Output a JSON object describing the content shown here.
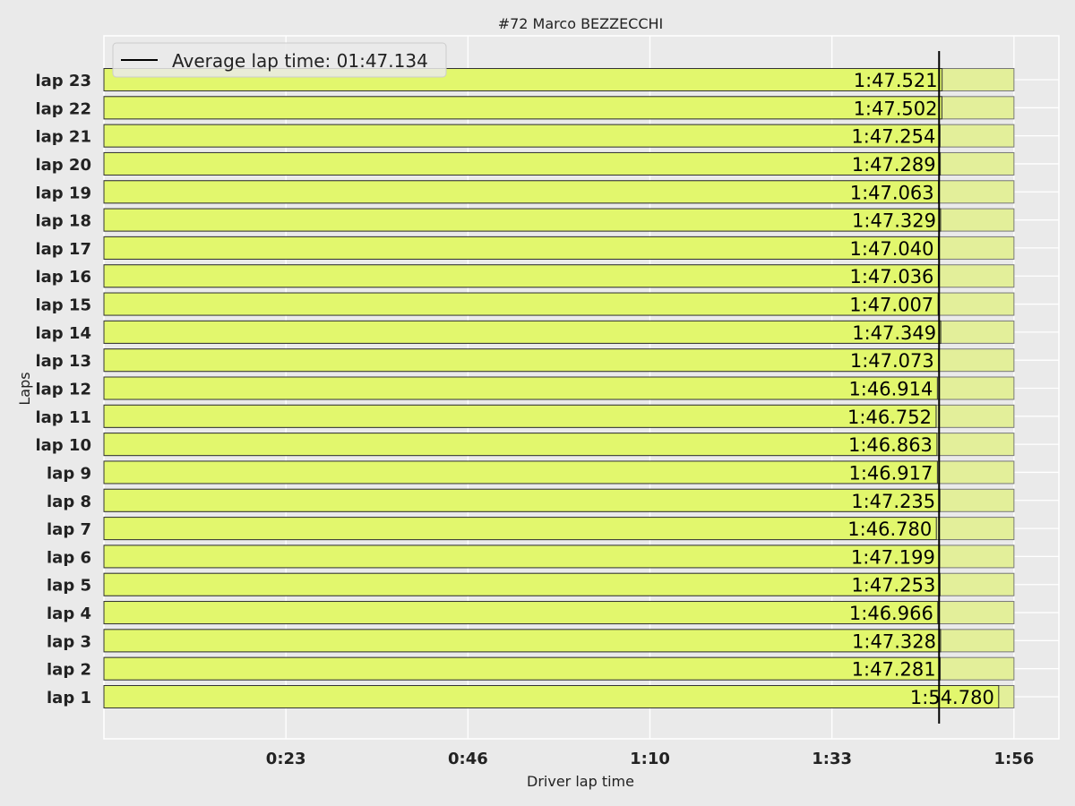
{
  "chart_data": {
    "type": "bar",
    "orientation": "horizontal",
    "title": "#72  Marco BEZZECCHI",
    "xlabel": "Driver lap time",
    "ylabel": "Laps",
    "categories": [
      "lap 1",
      "lap 2",
      "lap 3",
      "lap 4",
      "lap 5",
      "lap 6",
      "lap 7",
      "lap 8",
      "lap 9",
      "lap 10",
      "lap 11",
      "lap 12",
      "lap 13",
      "lap 14",
      "lap 15",
      "lap 16",
      "lap 17",
      "lap 18",
      "lap 19",
      "lap 20",
      "lap 21",
      "lap 22",
      "lap 23"
    ],
    "values_seconds": [
      114.78,
      107.281,
      107.328,
      106.966,
      107.253,
      107.199,
      106.78,
      107.235,
      106.917,
      106.863,
      106.752,
      106.914,
      107.073,
      107.349,
      107.007,
      107.036,
      107.04,
      107.329,
      107.063,
      107.289,
      107.254,
      107.502,
      107.521
    ],
    "value_labels": [
      "1:54.780",
      "1:47.281",
      "1:47.328",
      "1:46.966",
      "1:47.253",
      "1:47.199",
      "1:46.780",
      "1:47.235",
      "1:46.917",
      "1:46.863",
      "1:46.752",
      "1:46.914",
      "1:47.073",
      "1:47.349",
      "1:47.007",
      "1:47.036",
      "1:47.040",
      "1:47.329",
      "1:47.063",
      "1:47.289",
      "1:47.254",
      "1:47.502",
      "1:47.521"
    ],
    "background_bar_seconds": 116.74,
    "average_seconds": 107.134,
    "legend": {
      "entries": [
        "Average lap time: 01:47.134"
      ],
      "placement": "top-left"
    },
    "x_ticks": [
      {
        "value": 23.35,
        "label": "0:23"
      },
      {
        "value": 46.7,
        "label": "0:46"
      },
      {
        "value": 70.04,
        "label": "1:10"
      },
      {
        "value": 93.39,
        "label": "1:33"
      },
      {
        "value": 116.74,
        "label": "1:56"
      }
    ],
    "xlim": [
      0,
      122.5
    ],
    "grid": true,
    "colors": {
      "background": "#eaeaea",
      "bar": "#e2f76d",
      "bar_background": "#e3ef9a",
      "bar_edge": "#333333",
      "average_line": "#000000",
      "grid": "#ffffff"
    }
  }
}
